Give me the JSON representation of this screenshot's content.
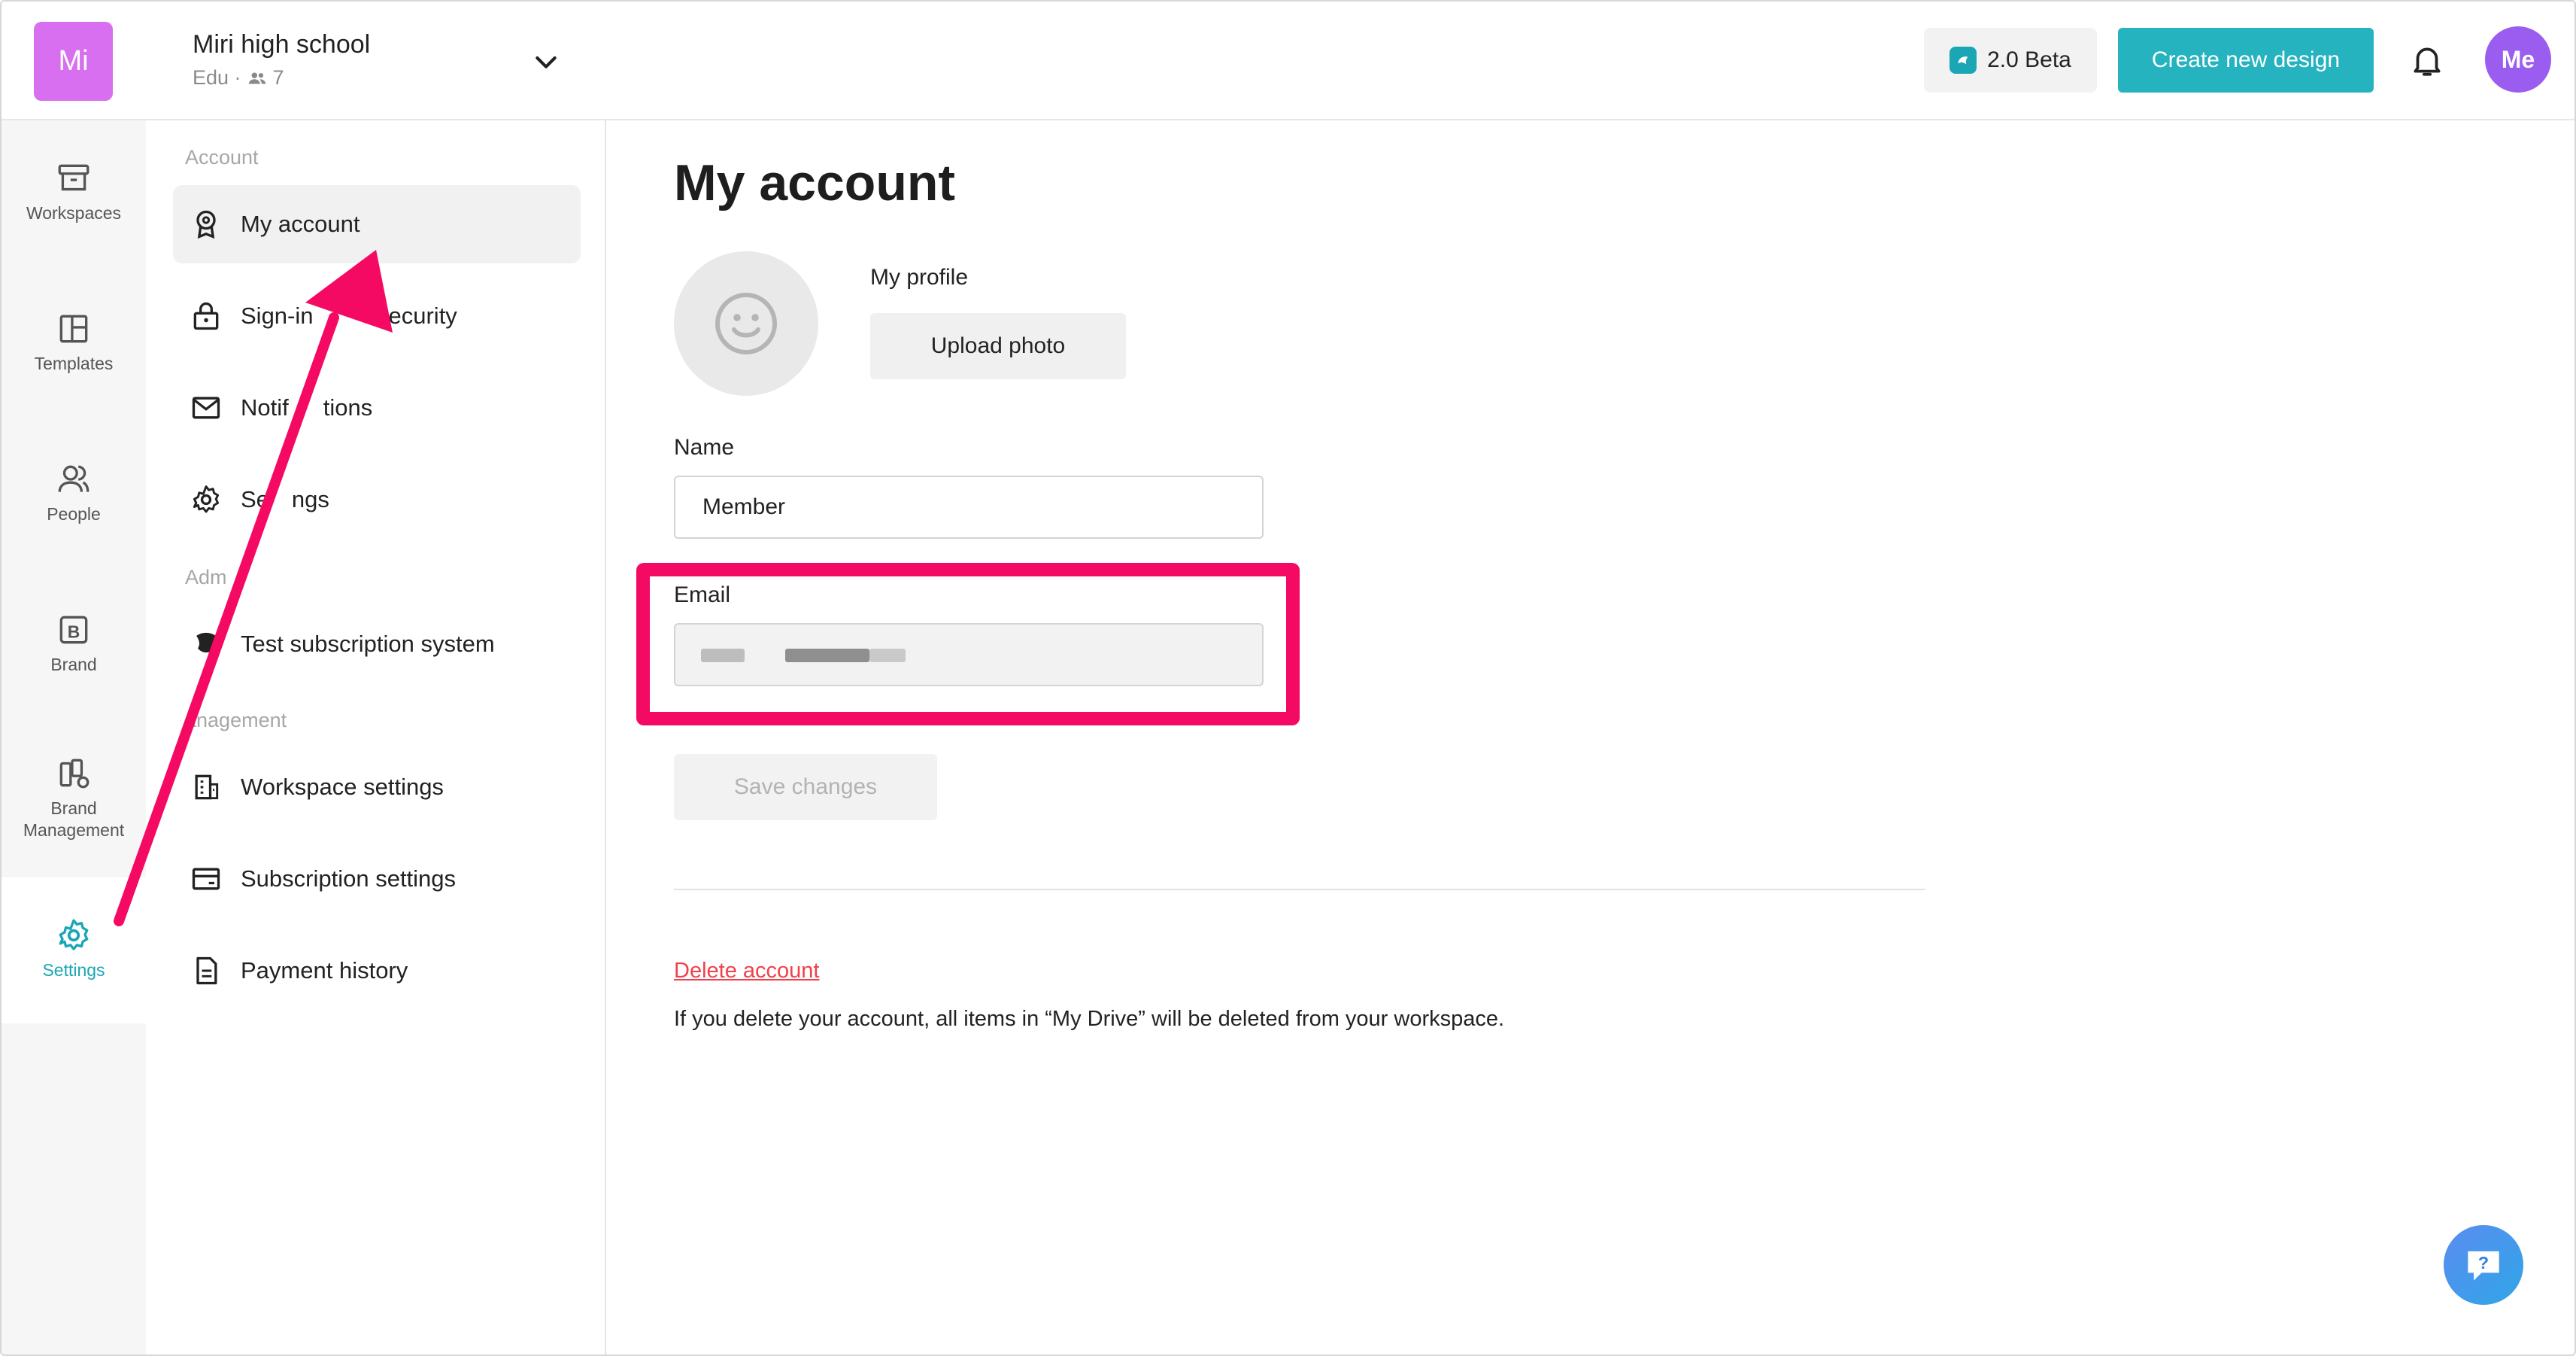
{
  "workspace": {
    "logo_text": "Mi",
    "name": "Miri high school",
    "plan": "Edu ·",
    "member_count": "7"
  },
  "topbar": {
    "beta_label": "2.0 Beta",
    "create_label": "Create new design",
    "user_initials": "Me"
  },
  "rail": {
    "items": [
      {
        "label": "Workspaces",
        "icon": "archive-icon"
      },
      {
        "label": "Templates",
        "icon": "layout-icon"
      },
      {
        "label": "People",
        "icon": "people-icon"
      },
      {
        "label": "Brand",
        "icon": "brand-b-icon"
      },
      {
        "label": "Brand",
        "label2": "Management",
        "icon": "brand-management-icon"
      },
      {
        "label": "Settings",
        "icon": "gear-icon",
        "active": true
      }
    ]
  },
  "nav": {
    "section_account": "Account",
    "section_admin": "Adm",
    "section_management": "anagement",
    "items": [
      {
        "label": "My account",
        "icon": "award-icon"
      },
      {
        "label": "Sign-in",
        "label_tail": "ecurity",
        "icon": "lock-icon"
      },
      {
        "label": "Notif",
        "label_tail": "tions",
        "icon": "mail-icon"
      },
      {
        "label": "Se",
        "label_tail": "ngs",
        "icon": "gear-icon"
      },
      {
        "label": "Test subscription system",
        "icon": "admin-icon"
      },
      {
        "label": "Workspace settings",
        "icon": "building-icon"
      },
      {
        "label": "Subscription settings",
        "icon": "card-icon"
      },
      {
        "label": "Payment history",
        "icon": "document-icon"
      }
    ]
  },
  "main": {
    "title": "My account",
    "profile_label": "My profile",
    "upload_label": "Upload photo",
    "name_label": "Name",
    "name_value": "Member",
    "email_label": "Email",
    "save_label": "Save changes",
    "delete_label": "Delete account",
    "delete_note": "If you delete your account, all items in “My Drive” will be deleted from your workspace."
  },
  "colors": {
    "accent": "#26b3c0",
    "highlight": "#f50a63",
    "danger": "#f0414b",
    "workspace_logo": "#d86ff0",
    "avatar": "#9b5cf0"
  }
}
